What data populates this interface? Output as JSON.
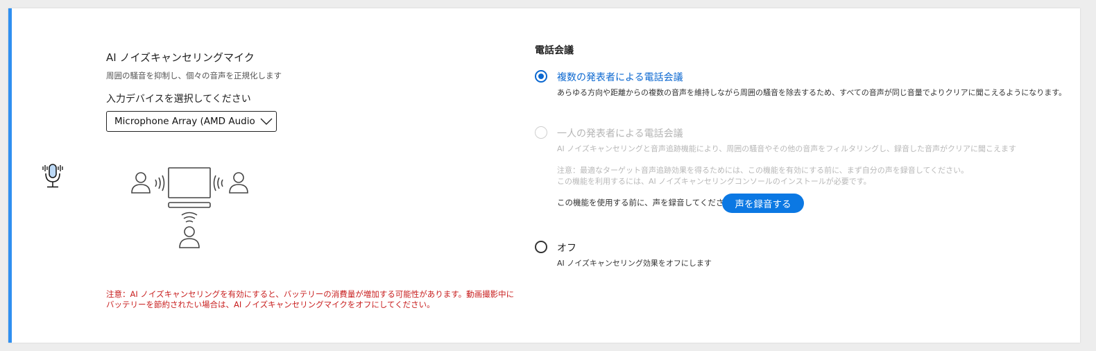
{
  "noise_cancel": {
    "title": "AI ノイズキャンセリングマイク",
    "subtitle": "周囲の騒音を抑制し、個々の音声を正規化します",
    "select_label": "入力デバイスを選択してください",
    "selected_device": "Microphone Array (AMD Audio D",
    "warning": "注意：AI ノイズキャンセリングを有効にすると、バッテリーの消費量が増加する可能性があります。動画撮影中にバッテリーを節約されたい場合は、AI ノイズキャンセリングマイクをオフにしてください。"
  },
  "conference": {
    "section_title": "電話会議",
    "options": [
      {
        "label": "複数の発表者による電話会議",
        "description": "あらゆる方向や距離からの複数の音声を維持しながら周囲の騒音を除去するため、すべての音声が同じ音量でよりクリアに聞こえるようになります。",
        "state": "selected"
      },
      {
        "label": "一人の発表者による電話会議",
        "description": "AI ノイズキャンセリングと音声追跡機能により、周囲の騒音やその他の音声をフィルタリングし、録音した音声がクリアに聞こえます",
        "note_line1": "注意：最適なターゲット音声追跡効果を得るためには、この機能を有効にする前に、まず自分の声を録音してください。",
        "note_line2": "この機能を利用するには、AI ノイズキャンセリングコンソールのインストールが必要です。",
        "record_hint": "この機能を使用する前に、声を録音してください",
        "record_button": "声を録音する",
        "state": "disabled"
      },
      {
        "label": "オフ",
        "description": "AI ノイズキャンセリング効果をオフにします",
        "state": "unselected"
      }
    ]
  },
  "colors": {
    "accent": "#0a67d0",
    "button": "#0b78e3",
    "warning": "#c81e1e",
    "left_border": "#2f8ff0"
  },
  "icons": {
    "mic": "microphone-icon",
    "dropdown": "chevron-down-icon",
    "illustration": "conference-illustration"
  }
}
